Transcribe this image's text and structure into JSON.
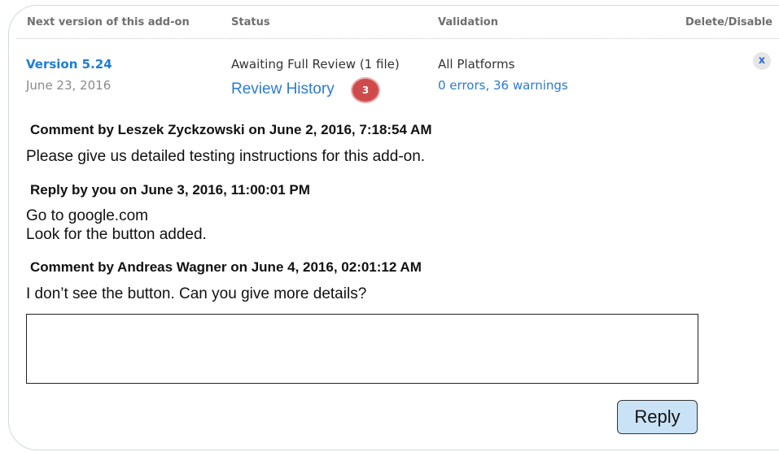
{
  "table": {
    "headers": {
      "version": "Next version of this add-on",
      "status": "Status",
      "validation": "Validation",
      "delete": "Delete/Disable"
    },
    "row": {
      "version_label": "Version 5.24",
      "version_date": "June 23, 2016",
      "status_text": "Awaiting Full Review (1 file)",
      "review_history_label": "Review History",
      "review_history_count": "3",
      "platforms": "All Platforms",
      "validation_summary": "0 errors, 36 warnings",
      "delete_icon_glyph": "x"
    }
  },
  "thread": [
    {
      "heading": "Comment by Leszek Zyckzowski on June 2, 2016, 7:18:54 AM",
      "lines": [
        "Please give us detailed testing instructions for this add-on."
      ]
    },
    {
      "heading": "Reply by you on June 3, 2016, 11:00:01 PM",
      "lines": [
        "Go to google.com",
        "Look for the button added."
      ]
    },
    {
      "heading": "Comment by Andreas Wagner on June 4, 2016, 02:01:12 AM",
      "lines": [
        "I don’t see the button. Can you give more details?"
      ]
    }
  ],
  "reply": {
    "value": "",
    "button_label": "Reply"
  },
  "colors": {
    "link": "#2b7bd1",
    "badge": "#cf4b4b",
    "reply_button": "#c9e2f6",
    "frame_border": "#cfd9e3"
  }
}
